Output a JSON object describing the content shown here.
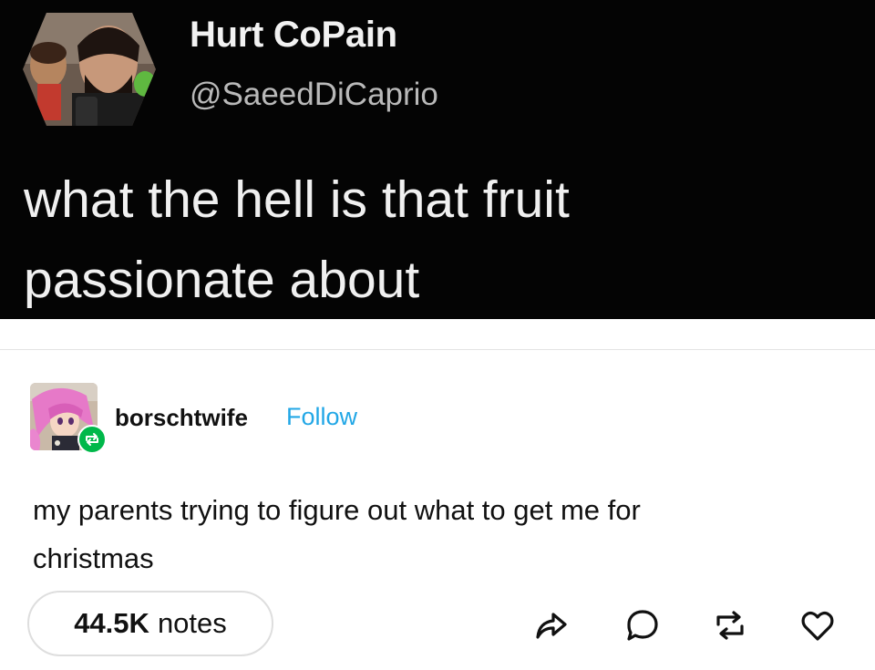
{
  "tweet": {
    "display_name": "Hurt CoPain",
    "handle": "@SaeedDiCaprio",
    "text_lines": [
      "what the hell is that fruit",
      "passionate about"
    ],
    "avatar_icon": "profile-photo-avatar"
  },
  "post": {
    "username": "borschtwife",
    "follow_label": "Follow",
    "avatar_icon": "anime-character-avatar",
    "reblog_badge_icon": "reblog-icon",
    "body_lines": [
      "my parents trying to figure out what to get me for",
      "christmas"
    ]
  },
  "footer": {
    "notes_count": "44.5K",
    "notes_label": "notes",
    "actions": [
      "share-icon",
      "reply-icon",
      "reblog-icon",
      "like-icon"
    ]
  },
  "colors": {
    "tweet_background": "#040404",
    "follow_blue": "#22a7e6",
    "reblog_green": "#00b84a"
  }
}
